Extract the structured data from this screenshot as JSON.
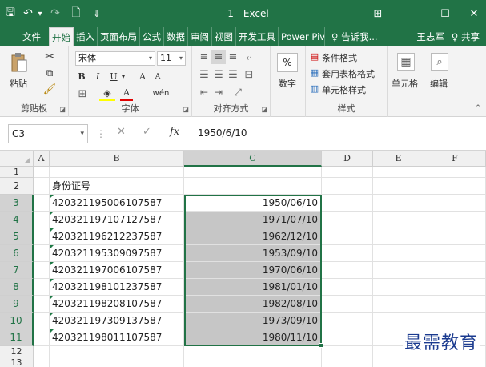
{
  "window": {
    "title": "1 - Excel",
    "controls": {
      "ribbon_display": "⊞",
      "minimize": "—",
      "maximize": "☐",
      "close": "✕"
    }
  },
  "qat": {
    "save": "🖫",
    "undo": "↶",
    "undo_drop": "▾",
    "redo": "↷",
    "preview": "🗋",
    "more": "⇓"
  },
  "tabs": [
    {
      "label": "文件"
    },
    {
      "label": "开始"
    },
    {
      "label": "插入"
    },
    {
      "label": "页面布局"
    },
    {
      "label": "公式"
    },
    {
      "label": "数据"
    },
    {
      "label": "审阅"
    },
    {
      "label": "视图"
    },
    {
      "label": "开发工具"
    },
    {
      "label": "Power Pivot"
    }
  ],
  "tell_me": "♀ 告诉我...",
  "user": "王志军",
  "share": "♀ 共享",
  "ribbon": {
    "clipboard": {
      "label": "剪贴板",
      "paste": "粘贴"
    },
    "font": {
      "label": "字体",
      "font_name": "宋体",
      "font_size": "11",
      "bold": "B",
      "italic": "I",
      "underline": "U",
      "grow": "A",
      "shrink": "A",
      "fontcolor": "A",
      "wen": "wén"
    },
    "alignment": {
      "label": "对齐方式"
    },
    "number": {
      "label": "数字",
      "percent": "%"
    },
    "styles": {
      "label": "样式",
      "conditional": "条件格式",
      "table": "套用表格格式",
      "cell_styles": "单元格样式"
    },
    "cells": {
      "label": "单元格"
    },
    "editing": {
      "label": "编辑"
    }
  },
  "formula_bar": {
    "name_box": "C3",
    "fx": "fx",
    "value": "1950/6/10"
  },
  "sheet": {
    "columns": [
      "A",
      "B",
      "C",
      "D",
      "E",
      "F"
    ],
    "rows": [
      "1",
      "2",
      "3",
      "4",
      "5",
      "6",
      "7",
      "8",
      "9",
      "10",
      "11",
      "12",
      "13"
    ],
    "header_b2": "身份证号",
    "ids": [
      "420321195006107587",
      "420321197107127587",
      "420321196212237587",
      "420321195309097587",
      "420321197006107587",
      "420321198101237587",
      "420321198208107587",
      "420321197309137587",
      "420321198011107587"
    ],
    "dates": [
      "1950/06/10",
      "1971/07/10",
      "1962/12/10",
      "1953/09/10",
      "1970/06/10",
      "1981/01/10",
      "1982/08/10",
      "1973/09/10",
      "1980/11/10"
    ]
  },
  "watermark": "最需教育",
  "colors": {
    "accent": "#217346",
    "selection": "#c6c6c6"
  }
}
